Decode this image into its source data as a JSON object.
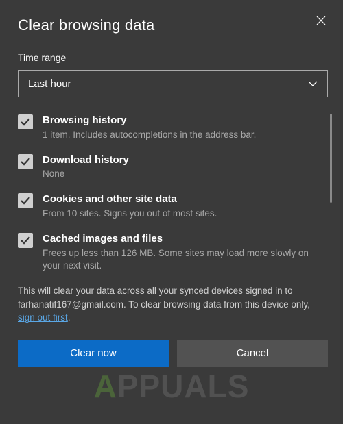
{
  "dialog": {
    "title": "Clear browsing data",
    "timeRangeLabel": "Time range",
    "timeRangeValue": "Last hour"
  },
  "items": [
    {
      "title": "Browsing history",
      "desc": "1 item. Includes autocompletions in the address bar.",
      "checked": true
    },
    {
      "title": "Download history",
      "desc": "None",
      "checked": true
    },
    {
      "title": "Cookies and other site data",
      "desc": "From 10 sites. Signs you out of most sites.",
      "checked": true
    },
    {
      "title": "Cached images and files",
      "desc": "Frees up less than 126 MB. Some sites may load more slowly on your next visit.",
      "checked": true
    }
  ],
  "disclaimer": {
    "pre": "This will clear your data across all your synced devices signed in to farhanatif167@gmail.com. To clear browsing data from this device only, ",
    "link": "sign out first",
    "post": "."
  },
  "buttons": {
    "primary": "Clear now",
    "secondary": "Cancel"
  },
  "watermark": {
    "a": "A",
    "rest": "PPUALS"
  }
}
